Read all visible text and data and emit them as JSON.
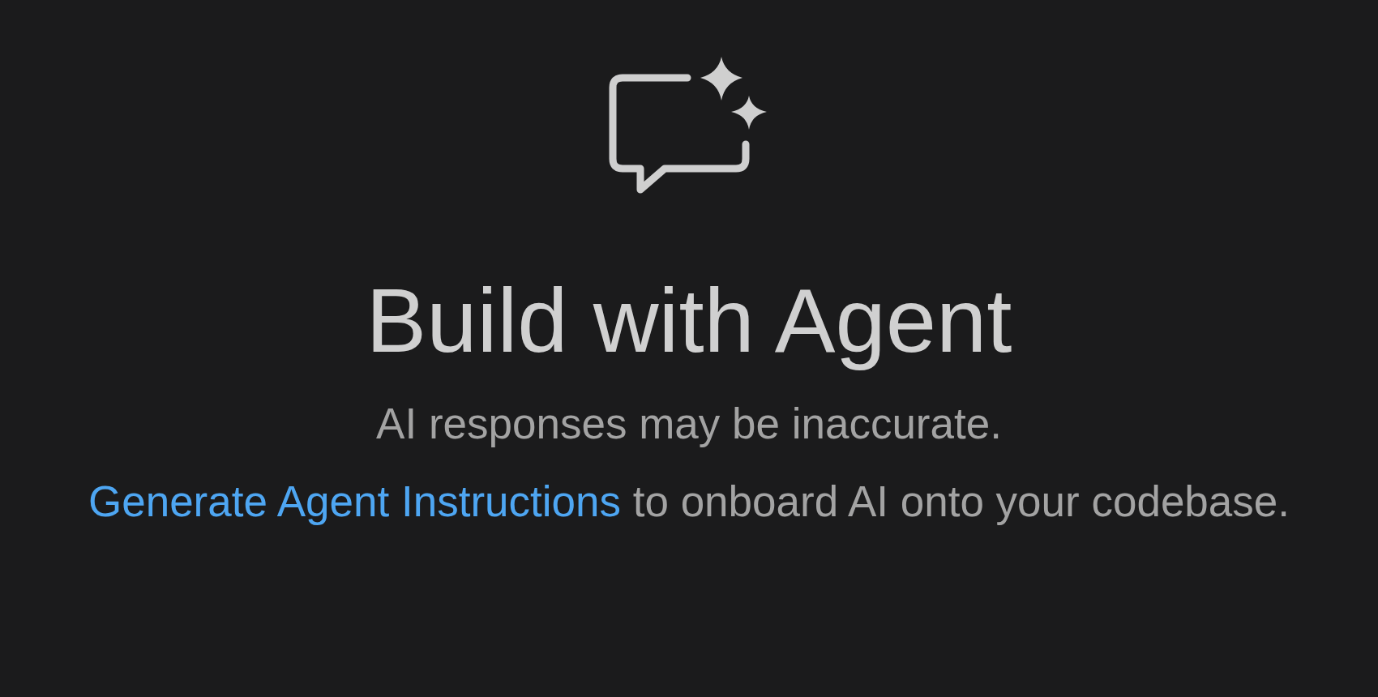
{
  "heading": "Build with Agent",
  "subtitle": "AI responses may be inaccurate.",
  "instructions": {
    "link": "Generate Agent Instructions",
    "text": "to onboard AI onto your codebase."
  }
}
